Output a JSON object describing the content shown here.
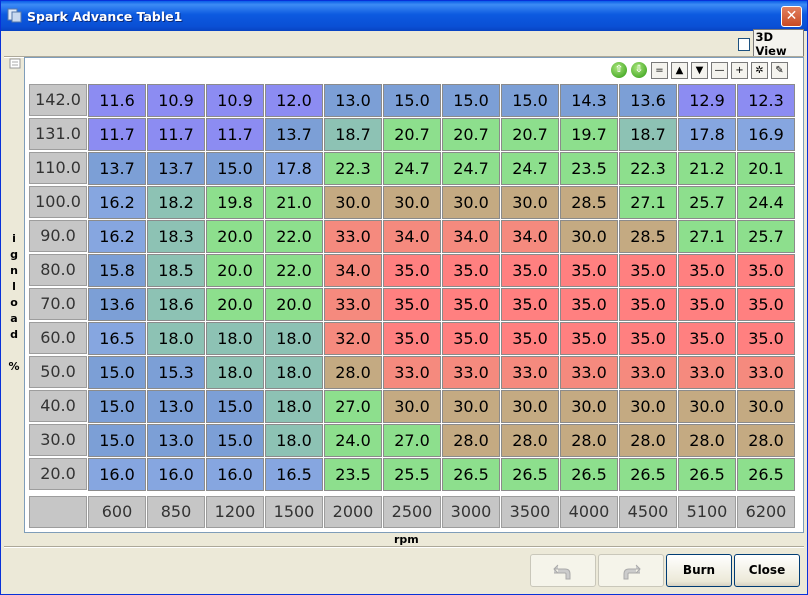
{
  "window": {
    "title": "Spark Advance Table1"
  },
  "header": {
    "view3d_label": "3D View",
    "view3d_checked": false
  },
  "toolbar": {
    "buttons": [
      "⇧",
      "⇩",
      "=",
      "▲",
      "▼",
      "—",
      "+",
      "✲",
      "✎"
    ]
  },
  "axes": {
    "y_label_chars": [
      "i",
      "g",
      "n",
      "l",
      "o",
      "a",
      "d",
      "",
      "%"
    ],
    "x_label": "rpm",
    "y_values": [
      "142.0",
      "131.0",
      "110.0",
      "100.0",
      "90.0",
      "80.0",
      "70.0",
      "60.0",
      "50.0",
      "40.0",
      "30.0",
      "20.0"
    ],
    "x_values": [
      "600",
      "850",
      "1200",
      "1500",
      "2000",
      "2500",
      "3000",
      "3500",
      "4000",
      "4500",
      "5100",
      "6200"
    ]
  },
  "table": {
    "rows": [
      [
        "11.6",
        "10.9",
        "10.9",
        "12.0",
        "13.0",
        "15.0",
        "15.0",
        "15.0",
        "14.3",
        "13.6",
        "12.9",
        "12.3"
      ],
      [
        "11.7",
        "11.7",
        "11.7",
        "13.7",
        "18.7",
        "20.7",
        "20.7",
        "20.7",
        "19.7",
        "18.7",
        "17.8",
        "16.9"
      ],
      [
        "13.7",
        "13.7",
        "15.0",
        "17.8",
        "22.3",
        "24.7",
        "24.7",
        "24.7",
        "23.5",
        "22.3",
        "21.2",
        "20.1"
      ],
      [
        "16.2",
        "18.2",
        "19.8",
        "21.0",
        "30.0",
        "30.0",
        "30.0",
        "30.0",
        "28.5",
        "27.1",
        "25.7",
        "24.4"
      ],
      [
        "16.2",
        "18.3",
        "20.0",
        "22.0",
        "33.0",
        "34.0",
        "34.0",
        "34.0",
        "30.0",
        "28.5",
        "27.1",
        "25.7"
      ],
      [
        "15.8",
        "18.5",
        "20.0",
        "22.0",
        "34.0",
        "35.0",
        "35.0",
        "35.0",
        "35.0",
        "35.0",
        "35.0",
        "35.0"
      ],
      [
        "13.6",
        "18.6",
        "20.0",
        "20.0",
        "33.0",
        "35.0",
        "35.0",
        "35.0",
        "35.0",
        "35.0",
        "35.0",
        "35.0"
      ],
      [
        "16.5",
        "18.0",
        "18.0",
        "18.0",
        "32.0",
        "35.0",
        "35.0",
        "35.0",
        "35.0",
        "35.0",
        "35.0",
        "35.0"
      ],
      [
        "15.0",
        "15.3",
        "18.0",
        "18.0",
        "28.0",
        "33.0",
        "33.0",
        "33.0",
        "33.0",
        "33.0",
        "33.0",
        "33.0"
      ],
      [
        "15.0",
        "13.0",
        "15.0",
        "18.0",
        "27.0",
        "30.0",
        "30.0",
        "30.0",
        "30.0",
        "30.0",
        "30.0",
        "30.0"
      ],
      [
        "15.0",
        "13.0",
        "15.0",
        "18.0",
        "24.0",
        "27.0",
        "28.0",
        "28.0",
        "28.0",
        "28.0",
        "28.0",
        "28.0"
      ],
      [
        "16.0",
        "16.0",
        "16.0",
        "16.5",
        "23.5",
        "25.5",
        "26.5",
        "26.5",
        "26.5",
        "26.5",
        "26.5",
        "26.5"
      ]
    ]
  },
  "colors": {
    "c1": "#8c8cf2",
    "c2": "#86a6e0",
    "c3": "#8dc2b4",
    "c4": "#8ddf8d",
    "c5": "#c4aa82",
    "c6": "#f58a7e",
    "c7": "#ff8080",
    "c8": "#7c9fd6"
  },
  "buttons": {
    "burn": "Burn",
    "close": "Close"
  }
}
